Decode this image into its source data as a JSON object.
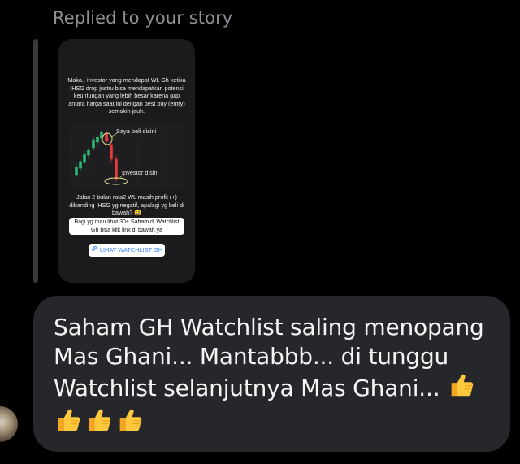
{
  "reply_caption": "Replied to your story",
  "story": {
    "text_top": "Maka.. investor yang mendapat WL Gh ketika IHSG drop justru bisa mendapatkan potensi keuntungan yang lebih besar karena gap antara harga saat ini dengan best buy (entry) semakin jauh.",
    "chart_label_buy": "Saya beli disini",
    "chart_label_investor": "Investor disini",
    "text_mid": "Jalan 2 bulan rata2 WL masih profit (+) dibanding IHSG yg negatif, apalagi yg beli di bawah? 😆",
    "box_text": "Bagi yg mau lihat 30+ Saham di Watchlist Gh bisa klik link di bawah ya",
    "link_text": "LIHAT WATCHLIST GH"
  },
  "message": {
    "text": "Saham GH Watchlist saling menopang Mas Ghani... Mantabbb... di tunggu Watchlist selanjutnya Mas Ghani...",
    "emoji_count": 4,
    "emoji_name": "thumbs-up"
  },
  "colors": {
    "background": "#000000",
    "bubble": "#26272b",
    "caption": "#8f8f95",
    "thumb": "#1b1b1d",
    "candle_up": "#2bb673",
    "candle_down": "#e23b3b",
    "highlight": "#f3e99a"
  }
}
